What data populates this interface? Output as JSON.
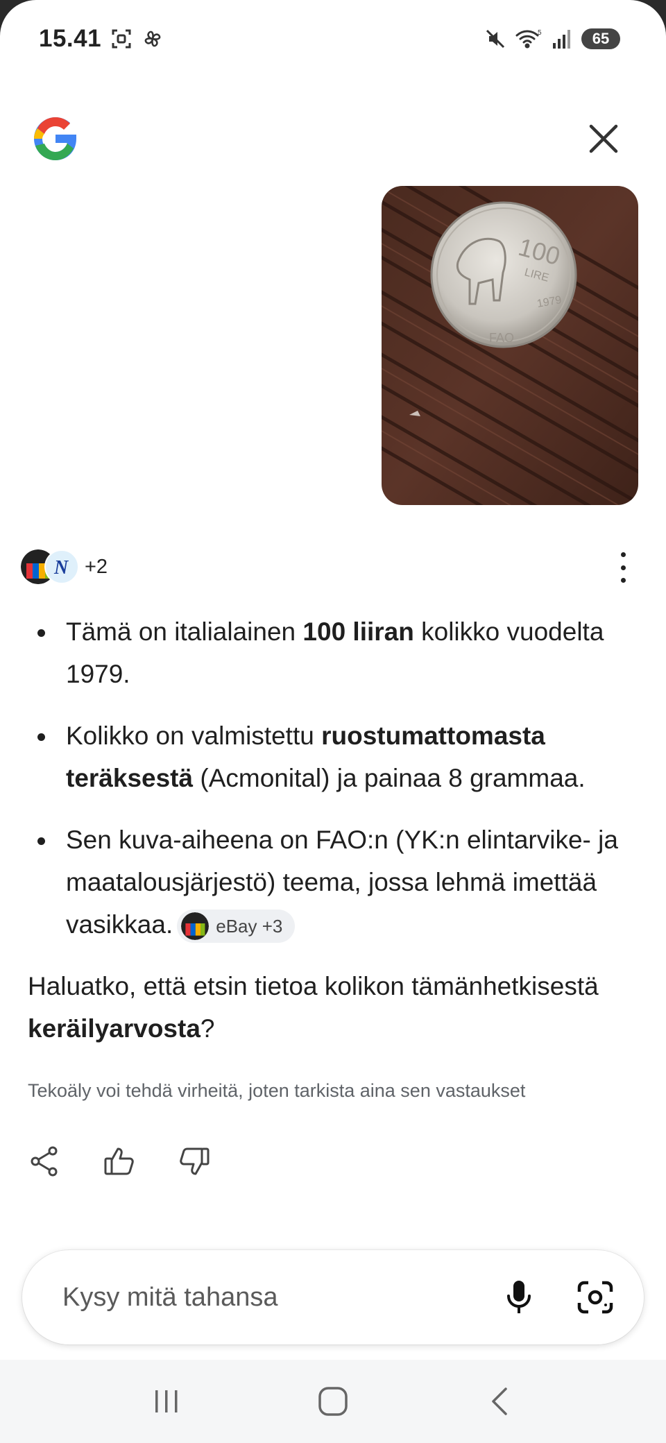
{
  "status_bar": {
    "time": "15.41",
    "battery": "65",
    "left_icons": [
      "screenshot-icon",
      "pinwheel-icon"
    ],
    "right_icons": [
      "mute-icon",
      "wifi-icon",
      "signal-icon",
      "battery-icon"
    ]
  },
  "header": {
    "logo": "google-g-icon",
    "close_icon": "close-icon"
  },
  "sources": {
    "more": "+2"
  },
  "answer": {
    "bullets": [
      {
        "pre": "Tämä on italialainen ",
        "bold": "100 liiran",
        "post": " kolikko vuodelta 1979."
      },
      {
        "pre": "Kolikko on valmistettu ",
        "bold": "ruostumattomasta teräksestä",
        "post": " (Acmonital) ja painaa 8 grammaa."
      },
      {
        "pre": "Sen kuva-aiheena on FAO:n (YK:n elintarvike- ja maatalousjärjestö) teema, jossa lehmä imettää vasikkaa.",
        "bold": "",
        "post": ""
      }
    ],
    "chip_label": "eBay +3",
    "question_pre": "Haluatko, että etsin tietoa kolikon tämänhetkisestä ",
    "question_bold": "keräilyarvosta",
    "question_post": "?",
    "disclaimer": "Tekoäly voi tehdä virheitä, joten tarkista aina sen vastaukset"
  },
  "actions": [
    "share-icon",
    "thumbs-up-icon",
    "thumbs-down-icon"
  ],
  "ask_bar": {
    "placeholder": "Kysy mitä tahansa",
    "mic_icon": "mic-icon",
    "lens_icon": "lens-camera-icon"
  },
  "navbar": [
    "recents-icon",
    "home-icon",
    "back-icon"
  ]
}
